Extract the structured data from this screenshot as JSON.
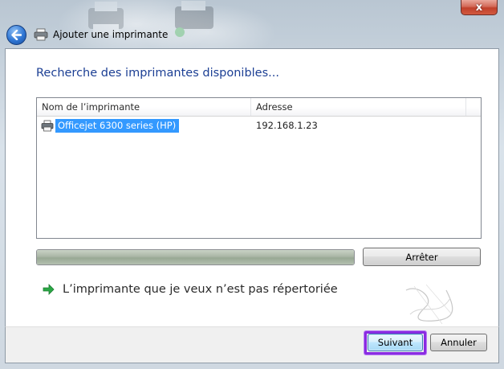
{
  "window": {
    "title": "Ajouter une imprimante",
    "close_glyph": "x"
  },
  "main": {
    "heading": "Recherche des imprimantes disponibles...",
    "printer_list": {
      "columns": [
        "Nom de l’imprimante",
        "Adresse"
      ],
      "rows": [
        {
          "name": "Officejet 6300 series (HP)",
          "address": "192.168.1.23",
          "icon": "printer-icon",
          "selected": true
        }
      ]
    },
    "progress_percent": 100,
    "stop_button_label": "Arrêter",
    "not_listed_link": "L’imprimante que je veux n’est pas répertoriée"
  },
  "footer": {
    "next_label": "Suivant",
    "cancel_label": "Annuler"
  },
  "colors": {
    "heading": "#1c3f94",
    "selection": "#3399ff",
    "focus_ring": "#8a2be2",
    "link_arrow": "#2aa845"
  },
  "icons": {
    "back": "back-arrow-icon",
    "title": "printer-icon",
    "link": "green-arrow-icon"
  }
}
